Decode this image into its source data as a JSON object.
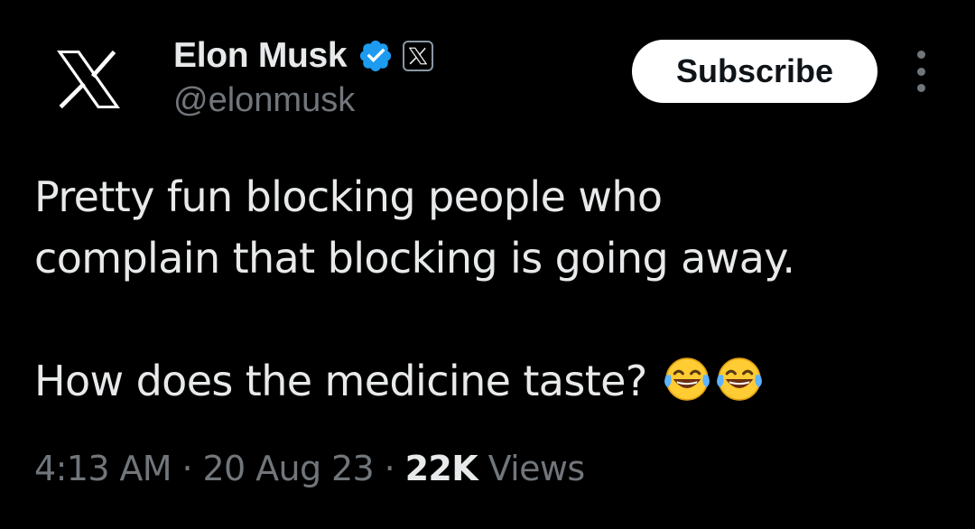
{
  "author": {
    "name": "Elon Musk",
    "handle": "@elonmusk",
    "avatar_icon": "x-logo-icon",
    "verified": true,
    "verified_color": "#1d9bf0",
    "affiliate_icon": "x-affiliate-badge-icon"
  },
  "actions": {
    "subscribe_label": "Subscribe",
    "more_icon": "more-vertical-icon"
  },
  "tweet": {
    "lines": [
      "Pretty fun blocking people who",
      "complain that blocking is going away."
    ],
    "line3": "How does the medicine taste?",
    "emojis": [
      "face-with-tears-of-joy-emoji",
      "face-with-tears-of-joy-emoji"
    ]
  },
  "meta": {
    "time": "4:13 AM",
    "sep1": "·",
    "date": "20 Aug 23",
    "sep2": "·",
    "views_count": "22K",
    "views_label": "Views"
  },
  "colors": {
    "background": "#000000",
    "text_primary": "#e7e9ea",
    "text_secondary": "#71767b",
    "button_bg": "#ffffff",
    "button_text": "#0f1419"
  }
}
